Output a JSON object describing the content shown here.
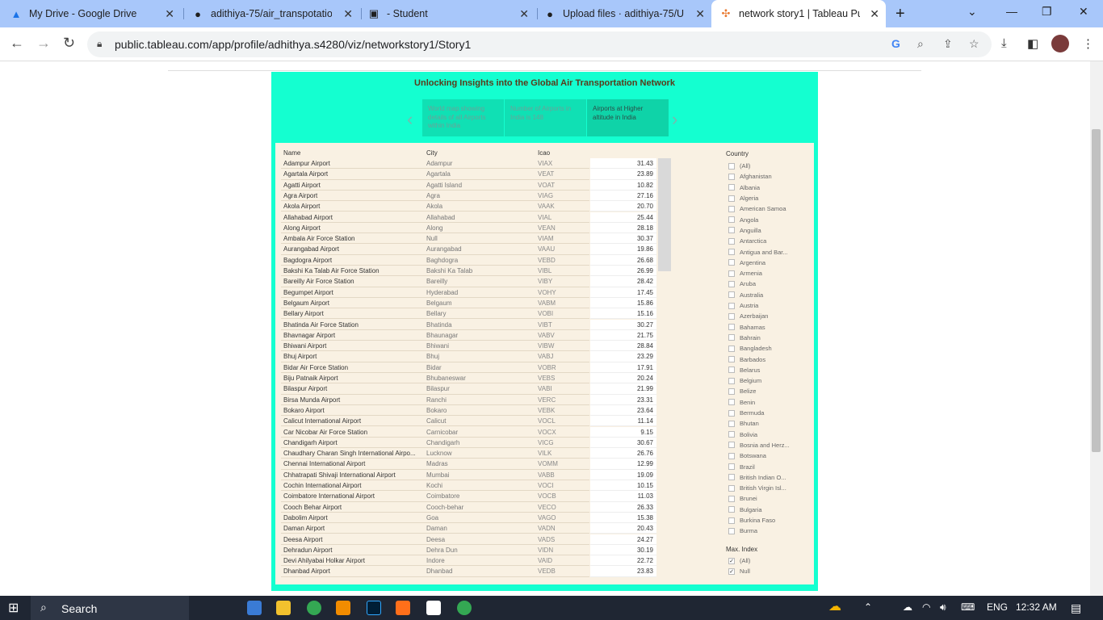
{
  "tabs": [
    {
      "title": "My Drive - Google Drive",
      "icon": "google-drive-icon"
    },
    {
      "title": "adithiya-75/air_transpotation",
      "icon": "github-icon"
    },
    {
      "title": "- Student",
      "icon": "student-portal-icon"
    },
    {
      "title": "Upload files · adithiya-75/Ur",
      "icon": "github-icon"
    },
    {
      "title": "network story1 | Tableau Pul",
      "icon": "tableau-icon"
    }
  ],
  "address": {
    "url": "public.tableau.com/app/profile/adhithya.s4280/viz/networkstory1/Story1"
  },
  "story": {
    "title": "Unlocking Insights into the Global Air Transportation Network",
    "points": [
      "World map showing details of all Airports within India",
      "Number of Airports in India is 148",
      "Airports at Higher altitude in India"
    ],
    "current_point": 2
  },
  "table": {
    "headers": [
      "Name",
      "City",
      "Icao"
    ],
    "rows": [
      [
        "Adampur Airport",
        "Adampur",
        "VIAX",
        "31.43"
      ],
      [
        "Agartala Airport",
        "Agartala",
        "VEAT",
        "23.89"
      ],
      [
        "Agatti Airport",
        "Agatti Island",
        "VOAT",
        "10.82"
      ],
      [
        "Agra Airport",
        "Agra",
        "VIAG",
        "27.16"
      ],
      [
        "Akola Airport",
        "Akola",
        "VAAK",
        "20.70"
      ],
      [
        "Allahabad Airport",
        "Allahabad",
        "VIAL",
        "25.44"
      ],
      [
        "Along Airport",
        "Along",
        "VEAN",
        "28.18"
      ],
      [
        "Ambala Air Force Station",
        "Null",
        "VIAM",
        "30.37"
      ],
      [
        "Aurangabad Airport",
        "Aurangabad",
        "VAAU",
        "19.86"
      ],
      [
        "Bagdogra Airport",
        "Baghdogra",
        "VEBD",
        "26.68"
      ],
      [
        "Bakshi Ka Talab Air Force Station",
        "Bakshi Ka Talab",
        "VIBL",
        "26.99"
      ],
      [
        "Bareilly Air Force Station",
        "Bareilly",
        "VIBY",
        "28.42"
      ],
      [
        "Begumpet Airport",
        "Hyderabad",
        "VOHY",
        "17.45"
      ],
      [
        "Belgaum Airport",
        "Belgaum",
        "VABM",
        "15.86"
      ],
      [
        "Bellary Airport",
        "Bellary",
        "VOBI",
        "15.16"
      ],
      [
        "Bhatinda Air Force Station",
        "Bhatinda",
        "VIBT",
        "30.27"
      ],
      [
        "Bhavnagar Airport",
        "Bhaunagar",
        "VABV",
        "21.75"
      ],
      [
        "Bhiwani Airport",
        "Bhiwani",
        "VIBW",
        "28.84"
      ],
      [
        "Bhuj Airport",
        "Bhuj",
        "VABJ",
        "23.29"
      ],
      [
        "Bidar Air Force Station",
        "Bidar",
        "VOBR",
        "17.91"
      ],
      [
        "Biju Patnaik Airport",
        "Bhubaneswar",
        "VEBS",
        "20.24"
      ],
      [
        "Bilaspur Airport",
        "Bilaspur",
        "VABI",
        "21.99"
      ],
      [
        "Birsa Munda Airport",
        "Ranchi",
        "VERC",
        "23.31"
      ],
      [
        "Bokaro Airport",
        "Bokaro",
        "VEBK",
        "23.64"
      ],
      [
        "Calicut International Airport",
        "Calicut",
        "VOCL",
        "11.14"
      ],
      [
        "Car Nicobar Air Force Station",
        "Carnicobar",
        "VOCX",
        "9.15"
      ],
      [
        "Chandigarh Airport",
        "Chandigarh",
        "VICG",
        "30.67"
      ],
      [
        "Chaudhary Charan Singh International Airpo...",
        "Lucknow",
        "VILK",
        "26.76"
      ],
      [
        "Chennai International Airport",
        "Madras",
        "VOMM",
        "12.99"
      ],
      [
        "Chhatrapati Shivaji International Airport",
        "Mumbai",
        "VABB",
        "19.09"
      ],
      [
        "Cochin International Airport",
        "Kochi",
        "VOCI",
        "10.15"
      ],
      [
        "Coimbatore International Airport",
        "Coimbatore",
        "VOCB",
        "11.03"
      ],
      [
        "Cooch Behar Airport",
        "Cooch-behar",
        "VECO",
        "26.33"
      ],
      [
        "Dabolim Airport",
        "Goa",
        "VAGO",
        "15.38"
      ],
      [
        "Daman Airport",
        "Daman",
        "VADN",
        "20.43"
      ],
      [
        "Deesa Airport",
        "Deesa",
        "VADS",
        "24.27"
      ],
      [
        "Dehradun Airport",
        "Dehra Dun",
        "VIDN",
        "30.19"
      ],
      [
        "Devi Ahilyabai Holkar Airport",
        "Indore",
        "VAID",
        "22.72"
      ],
      [
        "Dhanbad Airport",
        "Dhanbad",
        "VEDB",
        "23.83"
      ]
    ]
  },
  "filters": {
    "country_label": "Country",
    "countries": [
      "(All)",
      "Afghanistan",
      "Albania",
      "Algeria",
      "American Samoa",
      "Angola",
      "Anguilla",
      "Antarctica",
      "Antigua and Bar...",
      "Argentina",
      "Armenia",
      "Aruba",
      "Australia",
      "Austria",
      "Azerbaijan",
      "Bahamas",
      "Bahrain",
      "Bangladesh",
      "Barbados",
      "Belarus",
      "Belgium",
      "Belize",
      "Benin",
      "Bermuda",
      "Bhutan",
      "Bolivia",
      "Bosnia and Herz...",
      "Botswana",
      "Brazil",
      "British Indian O...",
      "British Virgin Isl...",
      "Brunei",
      "Bulgaria",
      "Burkina Faso",
      "Burma"
    ],
    "max_index_label": "Max. Index",
    "max_index_options": [
      "(All)",
      "Null"
    ],
    "check_mark": "✓"
  },
  "taskbar": {
    "search_label": "Search",
    "language": "ENG",
    "time": "12:32 AM"
  }
}
